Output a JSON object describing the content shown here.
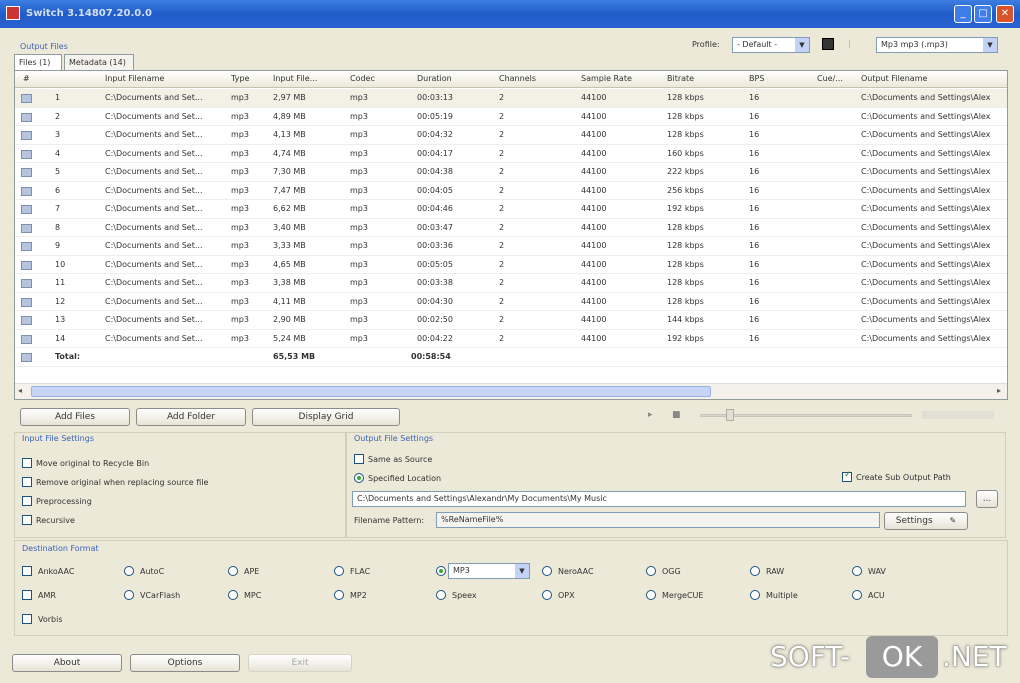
{
  "window": {
    "title": "Switch 3.14807.20.0.0",
    "minimize": "_",
    "maximize": "□",
    "close": "✕"
  },
  "top": {
    "section_label": "Output Files",
    "profile_label": "Profile:",
    "profile_value": "- Default -",
    "format_combo": "Mp3 mp3 (.mp3)"
  },
  "tabs": [
    {
      "label": "Files (1)"
    },
    {
      "label": "Metadata (14)"
    }
  ],
  "grid": {
    "columns": [
      "#",
      "Input Filename",
      "Type",
      "Input File...",
      "Codec",
      "Duration",
      "Channels",
      "Sample Rate",
      "Bitrate",
      "BPS",
      "Cue/...",
      "Output Filename"
    ],
    "rows": [
      [
        "1",
        "C:\\Documents and Set...",
        "mp3",
        "2,97 MB",
        "mp3",
        "00:03:13",
        "2",
        "44100",
        "128 kbps",
        "16",
        "",
        "C:\\Documents and Settings\\Alex"
      ],
      [
        "2",
        "C:\\Documents and Set...",
        "mp3",
        "4,89 MB",
        "mp3",
        "00:05:19",
        "2",
        "44100",
        "128 kbps",
        "16",
        "",
        "C:\\Documents and Settings\\Alex"
      ],
      [
        "3",
        "C:\\Documents and Set...",
        "mp3",
        "4,13 MB",
        "mp3",
        "00:04:32",
        "2",
        "44100",
        "128 kbps",
        "16",
        "",
        "C:\\Documents and Settings\\Alex"
      ],
      [
        "4",
        "C:\\Documents and Set...",
        "mp3",
        "4,74 MB",
        "mp3",
        "00:04:17",
        "2",
        "44100",
        "160 kbps",
        "16",
        "",
        "C:\\Documents and Settings\\Alex"
      ],
      [
        "5",
        "C:\\Documents and Set...",
        "mp3",
        "7,30 MB",
        "mp3",
        "00:04:38",
        "2",
        "44100",
        "222 kbps",
        "16",
        "",
        "C:\\Documents and Settings\\Alex"
      ],
      [
        "6",
        "C:\\Documents and Set...",
        "mp3",
        "7,47 MB",
        "mp3",
        "00:04:05",
        "2",
        "44100",
        "256 kbps",
        "16",
        "",
        "C:\\Documents and Settings\\Alex"
      ],
      [
        "7",
        "C:\\Documents and Set...",
        "mp3",
        "6,62 MB",
        "mp3",
        "00:04:46",
        "2",
        "44100",
        "192 kbps",
        "16",
        "",
        "C:\\Documents and Settings\\Alex"
      ],
      [
        "8",
        "C:\\Documents and Set...",
        "mp3",
        "3,40 MB",
        "mp3",
        "00:03:47",
        "2",
        "44100",
        "128 kbps",
        "16",
        "",
        "C:\\Documents and Settings\\Alex"
      ],
      [
        "9",
        "C:\\Documents and Set...",
        "mp3",
        "3,33 MB",
        "mp3",
        "00:03:36",
        "2",
        "44100",
        "128 kbps",
        "16",
        "",
        "C:\\Documents and Settings\\Alex"
      ],
      [
        "10",
        "C:\\Documents and Set...",
        "mp3",
        "4,65 MB",
        "mp3",
        "00:05:05",
        "2",
        "44100",
        "128 kbps",
        "16",
        "",
        "C:\\Documents and Settings\\Alex"
      ],
      [
        "11",
        "C:\\Documents and Set...",
        "mp3",
        "3,38 MB",
        "mp3",
        "00:03:38",
        "2",
        "44100",
        "128 kbps",
        "16",
        "",
        "C:\\Documents and Settings\\Alex"
      ],
      [
        "12",
        "C:\\Documents and Set...",
        "mp3",
        "4,11 MB",
        "mp3",
        "00:04:30",
        "2",
        "44100",
        "128 kbps",
        "16",
        "",
        "C:\\Documents and Settings\\Alex"
      ],
      [
        "13",
        "C:\\Documents and Set...",
        "mp3",
        "2,90 MB",
        "mp3",
        "00:02:50",
        "2",
        "44100",
        "144 kbps",
        "16",
        "",
        "C:\\Documents and Settings\\Alex"
      ],
      [
        "14",
        "C:\\Documents and Set...",
        "mp3",
        "5,24 MB",
        "mp3",
        "00:04:22",
        "2",
        "44100",
        "192 kbps",
        "16",
        "",
        "C:\\Documents and Settings\\Alex"
      ]
    ],
    "total": {
      "label": "Total:",
      "size": "65,53 MB",
      "duration": "00:58:54"
    }
  },
  "buttons": {
    "add_files": "Add Files",
    "add_folder": "Add Folder",
    "display_grid": "Display Grid"
  },
  "input_settings": {
    "title": "Input File Settings",
    "options": [
      "Move original to Recycle Bin",
      "Remove original when replacing source file",
      "Preprocessing",
      "Recursive"
    ]
  },
  "output_settings": {
    "title": "Output File Settings",
    "same_as_source": "Same as Source",
    "specified_location": "Specified Location",
    "create_sub": "Create Sub Output Path",
    "path": "C:\\Documents and Settings\\Alexandr\\My Documents\\My Music",
    "browse": "...",
    "filename_pattern_label": "Filename Pattern:",
    "filename_pattern_value": "%ReNameFile%",
    "settings": "Settings"
  },
  "destination": {
    "title": "Destination Format",
    "formats": [
      "AnkoAAC",
      "AutoC",
      "APE",
      "FLAC",
      "MP3",
      "NeroAAC",
      "OGG",
      "RAW",
      "WAV",
      "AMR",
      "VCarFlash",
      "MPC",
      "MP2",
      "Speex",
      "OPX",
      "MergeCUE",
      "Multiple",
      "ACU",
      "Vorbis"
    ]
  },
  "footer": {
    "about": "About",
    "options": "Options",
    "exit": "Exit"
  },
  "watermark": {
    "left": "SOFT-",
    "ok": "OK",
    "right": ".NET"
  }
}
